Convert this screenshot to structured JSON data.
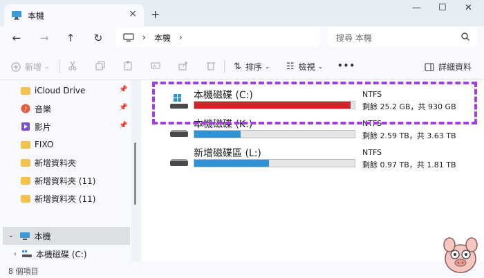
{
  "window": {
    "tab_title": "本機",
    "close_tab": "×",
    "new_tab": "+",
    "minimize": "—",
    "maximize": "☐",
    "close": "✕"
  },
  "nav": {
    "back": "←",
    "forward": "→",
    "up": "↑",
    "refresh": "↻",
    "breadcrumb": [
      "本機"
    ],
    "chevron": "›",
    "search_placeholder": "搜尋 本機"
  },
  "toolbar": {
    "new_label": "新增",
    "sort_label": "排序",
    "view_label": "檢視",
    "more_label": "•••",
    "details_label": "詳細資料"
  },
  "sidebar": {
    "items": [
      {
        "label": "iCloud Drive",
        "icon": "folder-icon",
        "pinned": true
      },
      {
        "label": "音樂",
        "icon": "music-icon",
        "pinned": true
      },
      {
        "label": "影片",
        "icon": "video-icon",
        "pinned": true
      },
      {
        "label": "FIXO",
        "icon": "folder-icon",
        "pinned": false
      },
      {
        "label": "新增資料夾",
        "icon": "folder-icon",
        "pinned": false
      },
      {
        "label": "新增資料夾 (11)",
        "icon": "folder-icon",
        "pinned": false
      },
      {
        "label": "新增資料夾 (11)",
        "icon": "folder-icon",
        "pinned": false
      },
      {
        "label": "本機",
        "icon": "pc-icon",
        "pinned": false,
        "selected": true
      },
      {
        "label": "本機磁碟 (C:)",
        "icon": "drive-icon",
        "pinned": false
      }
    ]
  },
  "drives": [
    {
      "name": "本機磁碟 (C:)",
      "fs": "NTFS",
      "free": "剩餘 25.2 GB，共 930 GB",
      "used_fraction": 0.973,
      "color": "#d0262b"
    },
    {
      "name": "本機磁碟 (K:)",
      "fs": "NTFS",
      "free": "剩餘 2.59 TB，共 3.63 TB",
      "used_fraction": 0.287,
      "color": "#2f94d6"
    },
    {
      "name": "新增磁碟區 (L:)",
      "fs": "NTFS",
      "free": "剩餘 0.97 TB，共 1.81 TB",
      "used_fraction": 0.464,
      "color": "#2f94d6"
    }
  ],
  "status": {
    "item_count": "8 個項目"
  },
  "colors": {
    "highlight": "#a23fe0",
    "accent": "#2f94d6",
    "warning": "#d0262b"
  }
}
